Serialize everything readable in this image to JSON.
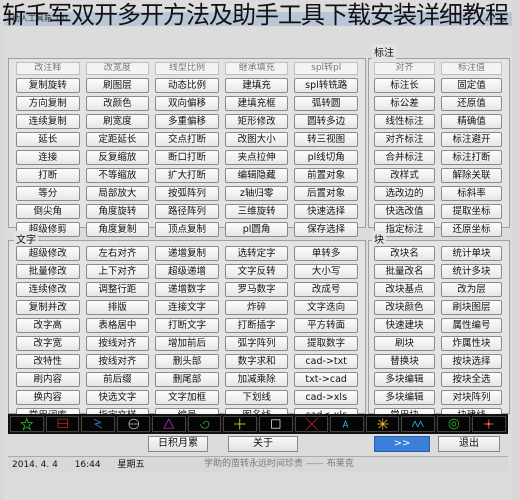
{
  "caption": "斩千军双开多开方法及助手工具下载安装详细教程",
  "window": {
    "title": "助人工具箱 1.0"
  },
  "left_top": {
    "headers": [
      "改注释",
      "改宽度",
      "线型比例",
      "继承填充",
      "spl转pl"
    ],
    "rows": [
      [
        "复制旋转",
        "刷图层",
        "动态比例",
        "建填充",
        "spl转铣路"
      ],
      [
        "方向复制",
        "改颜色",
        "双向偏移",
        "建填充框",
        "弧转圆"
      ],
      [
        "连续复制",
        "刷宽度",
        "多重偏移",
        "矩形修改",
        "圆转多边"
      ],
      [
        "延长",
        "定距延长",
        "交点打断",
        "改图大小",
        "转三视图"
      ],
      [
        "连接",
        "反复缩放",
        "断口打断",
        "夹点拉伸",
        "pl线切角"
      ],
      [
        "打断",
        "不等缩放",
        "扩大打断",
        "编辑隐藏",
        "前置对象"
      ],
      [
        "等分",
        "局部放大",
        "按弧阵列",
        "z轴归零",
        "后置对象"
      ],
      [
        "倒尖角",
        "角度旋转",
        "路径阵列",
        "三维旋转",
        "快速选择"
      ],
      [
        "超级修剪",
        "角度复制",
        "顶点复制",
        "pl圆角",
        "保存选择"
      ]
    ]
  },
  "right_top": {
    "label": "标注",
    "headers": [
      "对齐",
      "标注值"
    ],
    "rows": [
      [
        "标注长",
        "固定值"
      ],
      [
        "标公差",
        "还原值"
      ],
      [
        "线性标注",
        "精确值"
      ],
      [
        "对齐标注",
        "标注避开"
      ],
      [
        "合并标注",
        "标注打断"
      ],
      [
        "改样式",
        "解除关联"
      ],
      [
        "选改边的",
        "标斜率"
      ],
      [
        "快选改值",
        "提取坐标"
      ],
      [
        "指定标注",
        "还原坐标"
      ]
    ]
  },
  "text_section": {
    "label": "文字",
    "rows": [
      [
        "超级修改",
        "左右对齐",
        "递增复制",
        "选转定字",
        "单转多"
      ],
      [
        "批量修改",
        "上下对齐",
        "超级递增",
        "文字反转",
        "大小写"
      ],
      [
        "连续修改",
        "调整行距",
        "递增数字",
        "罗马数字",
        "改成号"
      ],
      [
        "复制并改",
        "排版",
        "连接文字",
        "炸碎",
        "文字迭向"
      ],
      [
        "改字高",
        "表格居中",
        "打断文字",
        "打断插字",
        "平方转面"
      ],
      [
        "改字宽",
        "按线对齐",
        "增加前后",
        "弧字阵列",
        "提取数字"
      ],
      [
        "改特性",
        "按线对齐",
        "删头部",
        "数字求和",
        "cad->txt"
      ],
      [
        "刷内容",
        "前后缀",
        "删尾部",
        "加减乘除",
        "txt->cad"
      ],
      [
        "换内容",
        "快选文字",
        "文字加框",
        "下划线",
        "cad->xls"
      ],
      [
        "常用词库",
        "指定文样",
        "编号",
        "图名线",
        "cad<-xls"
      ]
    ]
  },
  "block_section": {
    "label": "块",
    "rows": [
      [
        "改块名",
        "统计单块"
      ],
      [
        "批量改名",
        "统计多块"
      ],
      [
        "改块基点",
        "改为层"
      ],
      [
        "改块颜色",
        "刷块图层"
      ],
      [
        "快速建块",
        "属性编号"
      ],
      [
        "刷块",
        "炸属性块"
      ],
      [
        "替换块",
        "按块选择"
      ],
      [
        "多块编辑",
        "按块全选"
      ],
      [
        "多块编辑",
        "对块阵列"
      ],
      [
        "常用块",
        "块建线"
      ]
    ]
  },
  "preview_icons": [
    "star-pattern",
    "rectangle-grid",
    "bolt-shape",
    "circle-cross",
    "triangle-mark",
    "spiral-line",
    "crosshair",
    "square-frame",
    "cross-hatch",
    "letter-mark",
    "star-burst",
    "zigzag",
    "circle-ring",
    "dot-star"
  ],
  "bottom_bar": {
    "calendar": "日积月累",
    "about": "关于",
    "more": ">>",
    "exit": "退出"
  },
  "status": {
    "date": "2014. 4. 4",
    "time": "16:44",
    "weekday": "星期五",
    "watermark": "学助的蛮转永远时间珍贵 —— 布莱克"
  }
}
